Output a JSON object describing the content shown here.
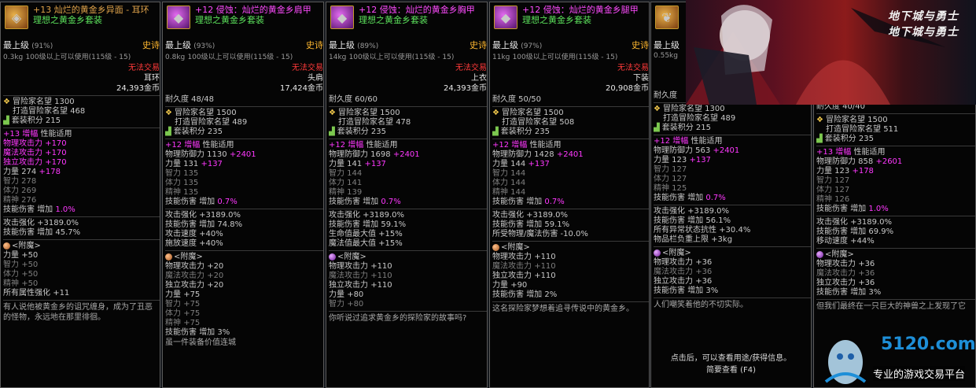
{
  "colors": {
    "epic": "#ffb830",
    "title": "#e0a34a",
    "purple": "#ff38ff",
    "set": "#5ce35c",
    "untradeable": "#ff3a3a"
  },
  "p1": {
    "icon": "earring-icon",
    "title": "+13 灿烂的黄金乡异面 - 耳环",
    "set": "理想之黄金乡套装",
    "grade": "最上级",
    "pct": "(91%)",
    "rarity": "史诗",
    "weight": "0.3kg",
    "req": "100级以上可以使用(115级 - 15)",
    "trade": "无法交易",
    "slot": "耳环",
    "price": "24,393金币",
    "fame": "冒险家名望 1300",
    "craft_lbl": "打造冒险家名望",
    "craft_val": "468",
    "set_lbl": "套装积分",
    "set_val": "215",
    "amp": "+13",
    "amp_lbl": "增幅",
    "perf": "性能适用",
    "s": [
      [
        "物理攻击力",
        "+170"
      ],
      [
        "魔法攻击力",
        "+170"
      ],
      [
        "独立攻击力",
        "+170"
      ]
    ],
    "str": "力量",
    "str_val": "274",
    "str_add": "+178",
    "int": "智力 278",
    "vit": "体力 269",
    "spi": "精神 276",
    "skd": "技能伤害",
    "inc": "增加",
    "skd_val": "1.0%",
    "atk": "攻击强化 +3189.0%",
    "skd2": "技能伤害 增加 45.7%",
    "ench": "<附魔>",
    "e": [
      [
        "力量",
        "+50"
      ],
      [
        "智力",
        "+50"
      ],
      [
        "体力",
        "+50"
      ],
      [
        "精神",
        "+50"
      ]
    ],
    "e5": [
      "所有属性强化",
      "+11"
    ],
    "desc": "有人说他被黄金乡的诅咒缠身，成为了丑恶的怪物，永远地在那里徘徊。"
  },
  "p2": {
    "icon": "shoulder-icon",
    "title": "+12 侵蚀：灿烂的黄金乡肩甲",
    "set": "理想之黄金乡套装",
    "grade": "最上级",
    "pct": "(93%)",
    "rarity": "史诗",
    "weight": "0.8kg",
    "req": "100级以上可以使用(115级 - 15)",
    "trade": "无法交易",
    "slot": "头肩",
    "price": "17,424金币",
    "dur": "耐久度 48/48",
    "fame": "冒险家名望 1500",
    "craft_lbl": "打造冒险家名望",
    "craft_val": "489",
    "set_lbl": "套装积分",
    "set_val": "235",
    "amp": "+12",
    "amp_lbl": "增幅",
    "perf": "性能适用",
    "def": "物理防御力 1130",
    "def_add": "+2401",
    "str": "力量 131",
    "str_add": "+137",
    "int": "智力 135",
    "vit": "体力 135",
    "spi": "精神 135",
    "skd": "技能伤害",
    "inc": "增加",
    "skd_val": "0.7%",
    "x": [
      "攻击强化 +3189.0%",
      "技能伤害 增加 74.8%",
      "攻击速度 +40%",
      "施放速度 +40%"
    ],
    "ench": "<附魔>",
    "e": [
      [
        "物理攻击力",
        "+20"
      ],
      [
        "魔法攻击力",
        "+20"
      ],
      [
        "独立攻击力",
        "+20"
      ],
      [
        "力量",
        "+75"
      ],
      [
        "智力",
        "+75"
      ],
      [
        "体力",
        "+75"
      ],
      [
        "精神",
        "+75"
      ]
    ],
    "e8": [
      "技能伤害",
      "增加",
      "3%"
    ],
    "desc": "虽一件装备价值连城"
  },
  "p3": {
    "icon": "chest-armor-icon",
    "title": "+12 侵蚀：灿烂的黄金乡胸甲",
    "set": "理想之黄金乡套装",
    "grade": "最上级",
    "pct": "(89%)",
    "rarity": "史诗",
    "weight": "14kg",
    "req": "100级以上可以使用(115级 - 15)",
    "trade": "无法交易",
    "slot": "上衣",
    "price": "24,393金币",
    "dur": "耐久度 60/60",
    "fame": "冒险家名望 1500",
    "craft_lbl": "打造冒险家名望",
    "craft_val": "478",
    "set_lbl": "套装积分",
    "set_val": "235",
    "amp": "+12",
    "amp_lbl": "增幅",
    "perf": "性能适用",
    "def": "物理防御力 1698",
    "def_add": "+2401",
    "str": "力量 141",
    "str_add": "+137",
    "int": "智力 144",
    "vit": "体力 141",
    "spi": "精神 139",
    "skd": "技能伤害",
    "inc": "增加",
    "skd_val": "0.7%",
    "x": [
      "攻击强化 +3189.0%",
      "技能伤害 增加 59.1%",
      "生命值最大值 +15%",
      "魔法值最大值 +15%"
    ],
    "ench": "<附魔>",
    "e": [
      [
        "物理攻击力",
        "+110"
      ],
      [
        "魔法攻击力",
        "+110"
      ],
      [
        "独立攻击力",
        "+110"
      ],
      [
        "力量",
        "+80"
      ],
      [
        "智力",
        "+80"
      ]
    ],
    "desc": "你听说过追求黄金乡的探险家的故事吗?"
  },
  "p4": {
    "icon": "leg-armor-icon",
    "title": "+12 侵蚀：灿烂的黄金乡腿甲",
    "set": "理想之黄金乡套装",
    "grade": "最上级",
    "pct": "(97%)",
    "rarity": "史诗",
    "weight": "11kg",
    "req": "100级以上可以使用(115级 - 15)",
    "trade": "无法交易",
    "slot": "下装",
    "price": "20,908金币",
    "dur": "耐久度 50/50",
    "fame": "冒险家名望 1500",
    "craft_lbl": "打造冒险家名望",
    "craft_val": "508",
    "set_lbl": "套装积分",
    "set_val": "235",
    "amp": "+12",
    "amp_lbl": "增幅",
    "perf": "性能适用",
    "def": "物理防御力 1428",
    "def_add": "+2401",
    "str": "力量 144",
    "str_add": "+137",
    "int": "智力 144",
    "vit": "体力 144",
    "spi": "精神 144",
    "skd": "技能伤害",
    "inc": "增加",
    "skd_val": "0.7%",
    "x": [
      "攻击强化 +3189.0%",
      "技能伤害 增加 59.1%",
      "所受物理/魔法伤害 -10.0%"
    ],
    "ench": "<附魔>",
    "e": [
      [
        "物理攻击力",
        "+110"
      ],
      [
        "魔法攻击力",
        "+110"
      ],
      [
        "独立攻击力",
        "+110"
      ],
      [
        "力量",
        "+90"
      ]
    ],
    "e5": [
      "技能伤害",
      "增加",
      "2%"
    ],
    "desc": "这名探险家梦想着追寻传说中的黄金乡。"
  },
  "p5": {
    "icon": "wing-icon",
    "grade": "最上级",
    "weight": "0.55kg",
    "dur": "耐久度",
    "fame": "冒险家名望 1300",
    "craft_lbl": "打造冒险家名望",
    "craft_val": "489",
    "set_lbl": "套装积分",
    "set_val": "215",
    "amp": "+12",
    "amp_lbl": "增幅",
    "perf": "性能适用",
    "def": "物理防御力 563",
    "def_add": "+2401",
    "str": "力量 123",
    "str_add": "+137",
    "int": "智力 127",
    "vit": "体力 127",
    "spi": "精神 125",
    "skd": "技能伤害",
    "inc": "增加",
    "skd_val": "0.7%",
    "x": [
      "攻击强化 +3189.0%",
      "技能伤害 增加 56.1%",
      "所有异常状态抗性 +30.4%",
      "物品栏负重上限 +3kg"
    ],
    "ench": "<附魔>",
    "e": [
      [
        "物理攻击力",
        "+36"
      ],
      [
        "魔法攻击力",
        "+36"
      ],
      [
        "独立攻击力",
        "+36"
      ]
    ],
    "e4": [
      "技能伤害",
      "增加",
      "3%"
    ],
    "desc": "人们嘲笑着他的不切实际。",
    "foot1": "点击后，可以查看用途/获得信息。",
    "foot2": "简要查看 (F4)"
  },
  "p6": {
    "dur": "耐久度 40/40",
    "fame": "冒险家名望 1500",
    "craft_lbl": "打造冒险家名望",
    "craft_val": "511",
    "set_lbl": "套装积分",
    "set_val": "235",
    "amp": "+13",
    "amp_lbl": "增幅",
    "perf": "性能适用",
    "def": "物理防御力 858",
    "def_add": "+2601",
    "str": "力量 123",
    "str_add": "+178",
    "int": "智力 127",
    "vit": "体力 127",
    "spi": "精神 126",
    "skd": "技能伤害",
    "inc": "增加",
    "skd_val": "1.0%",
    "x": [
      "攻击强化 +3189.0%",
      "技能伤害 增加 69.9%",
      "移动速度 +44%"
    ],
    "ench": "<附魔>",
    "e": [
      [
        "物理攻击力",
        "+36"
      ],
      [
        "魔法攻击力",
        "+36"
      ],
      [
        "独立攻击力",
        "+36"
      ]
    ],
    "e4": [
      "技能伤害",
      "增加",
      "3%"
    ],
    "desc": "但我们最终在一只巨大的神兽之上发现了它"
  },
  "banner": {
    "logo1": "地下城与勇士",
    "logo2": "地下城与勇士"
  },
  "wm": {
    "site": "5120.com",
    "sub": "专业的游戏交易平台"
  }
}
